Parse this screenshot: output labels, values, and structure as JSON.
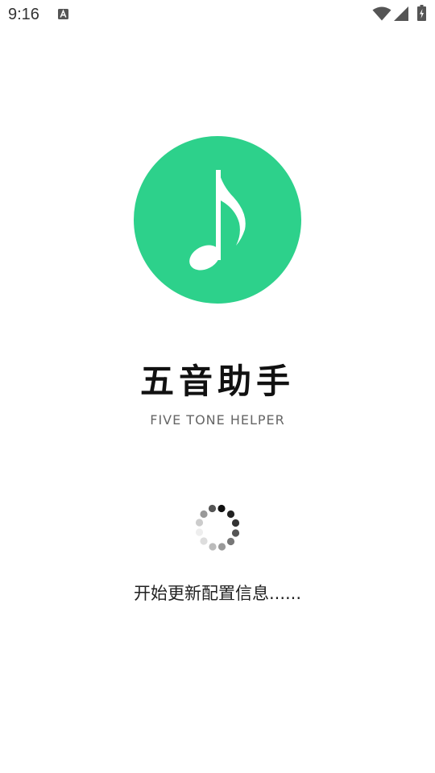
{
  "status_bar": {
    "time": "9:16",
    "notification_icon": "a-letter-icon",
    "wifi_icon": "wifi-icon",
    "signal_icon": "cell-signal-icon",
    "battery_icon": "battery-charging-icon"
  },
  "logo": {
    "icon": "music-note-icon",
    "background_color": "#2dd18b"
  },
  "app": {
    "title": "五音助手",
    "subtitle": "FIVE TONE HELPER"
  },
  "loading": {
    "spinner_icon": "loading-spinner-icon",
    "message": "开始更新配置信息......"
  }
}
